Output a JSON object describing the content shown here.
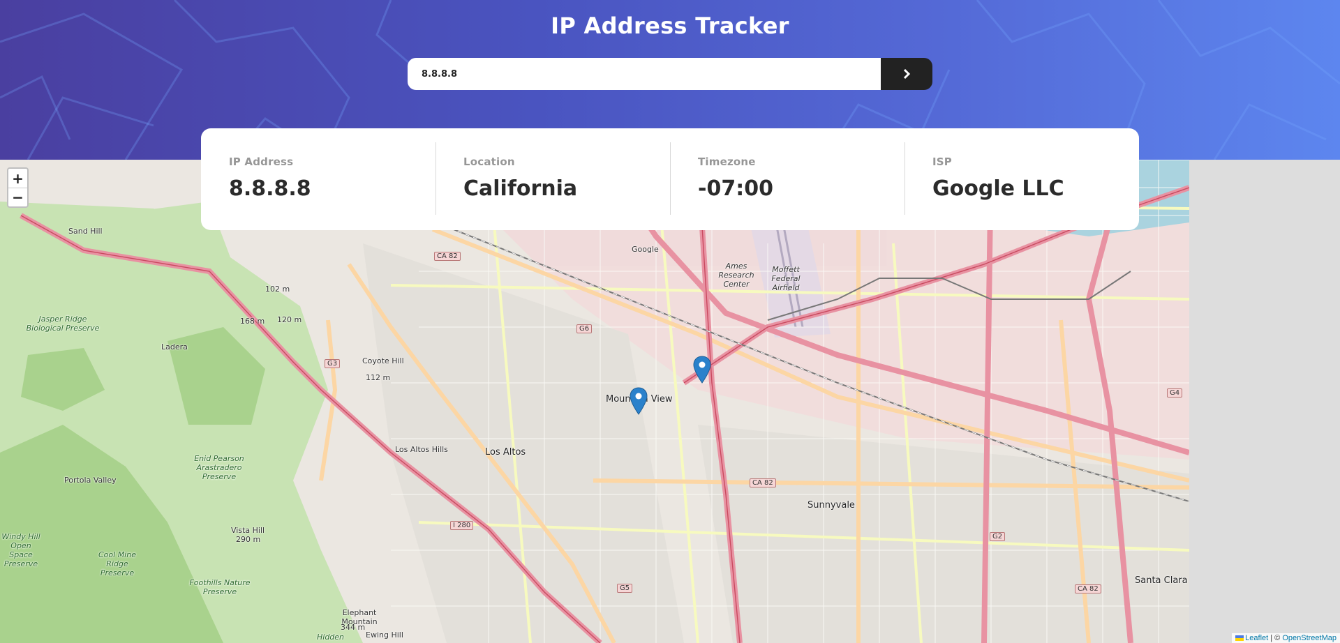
{
  "header": {
    "title": "IP Address Tracker",
    "search_value": "8.8.8.8",
    "submit_icon": "chevron-right-icon"
  },
  "info": [
    {
      "label": "IP Address",
      "value": "8.8.8.8"
    },
    {
      "label": "Location",
      "value": "California"
    },
    {
      "label": "Timezone",
      "value": "-07:00"
    },
    {
      "label": "ISP",
      "value": "Google LLC"
    }
  ],
  "map": {
    "zoom_in": "+",
    "zoom_out": "−",
    "attribution": {
      "leaflet": "Leaflet",
      "separator": " | © ",
      "osm": "OpenStreetMap"
    },
    "labels": {
      "mountain_view": "Mountain View",
      "los_altos": "Los Altos",
      "los_altos_hills": "Los Altos Hills",
      "sunnyvale": "Sunnyvale",
      "santa_clara": "Santa Clara",
      "portola_valley": "Portola Valley",
      "ladera": "Ladera",
      "sand_hill": "Sand Hill",
      "coyote_hill": "Coyote Hill",
      "coyote_hill_elev": "112 m",
      "jasper_ridge": "Jasper Ridge Biological Preserve",
      "enid_pearson": "Enid Pearson Arastradero Preserve",
      "foothills": "Foothills Nature Preserve",
      "windy_hill": "Windy Hill Open Space Preserve",
      "cool_mine": "Cool Mine Ridge Preserve",
      "vista_hill": "Vista Hill",
      "vista_hill_elev": "290 m",
      "elephant_mountain": "Elephant Mountain",
      "elephant_mountain_elev": "344 m",
      "ewing_hill": "Ewing Hill",
      "hidden": "Hidden",
      "moffett": "Moffett Federal Airfield",
      "ames": "Ames Research Center",
      "google": "Google",
      "elev_102": "102 m",
      "elev_168": "168 m",
      "elev_120": "120 m"
    },
    "shields": [
      "CA 82",
      "G6",
      "G3",
      "I 280",
      "G5",
      "G2",
      "G4",
      "CA 82",
      "CA 82"
    ],
    "marker_color": "#2a81cb"
  },
  "colors": {
    "header_start": "#4a3fa0",
    "header_end": "#5d86ef",
    "button": "#222222"
  }
}
